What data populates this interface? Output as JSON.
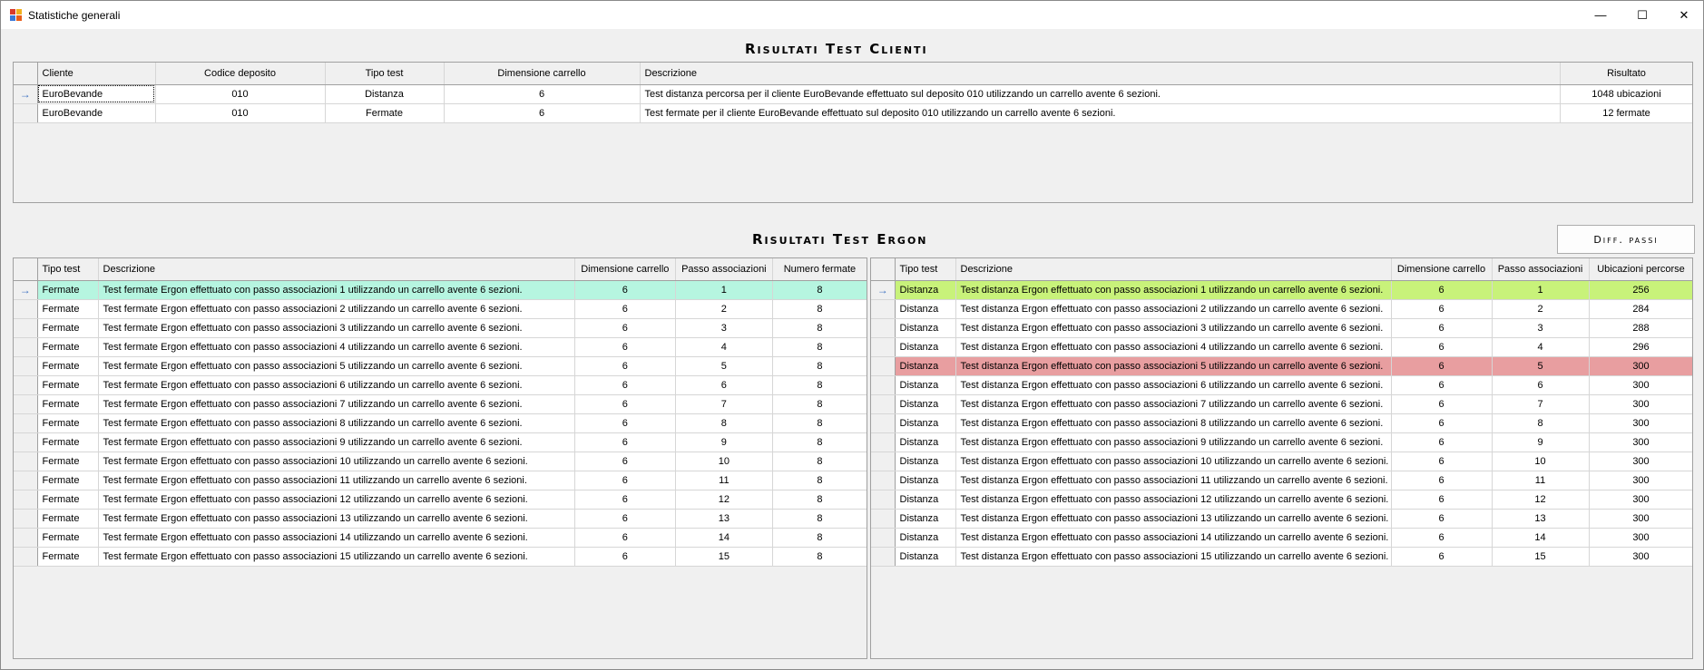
{
  "window": {
    "title": "Statistiche generali",
    "minimize_glyph": "—",
    "maximize_glyph": "☐",
    "close_glyph": "✕"
  },
  "clienti": {
    "title": "Risultati Test Clienti",
    "columns": [
      "Cliente",
      "Codice deposito",
      "Tipo test",
      "Dimensione carrello",
      "Descrizione",
      "Risultato"
    ],
    "rows": [
      [
        "EuroBevande",
        "010",
        "Distanza",
        "6",
        "Test distanza percorsa per il cliente EuroBevande effettuato sul deposito 010 utilizzando un carrello avente 6 sezioni.",
        "1048 ubicazioni"
      ],
      [
        "EuroBevande",
        "010",
        "Fermate",
        "6",
        "Test fermate per il cliente EuroBevande effettuato sul deposito 010 utilizzando un carrello avente 6 sezioni.",
        "12 fermate"
      ]
    ]
  },
  "ergon": {
    "title": "Risultati Test Ergon",
    "diff_button": "Diff. passi",
    "fermate": {
      "columns": [
        "Tipo test",
        "Descrizione",
        "Dimensione carrello",
        "Passo associazioni",
        "Numero fermate"
      ],
      "rows": [
        [
          "Fermate",
          "Test fermate Ergon effettuato con passo associazioni 1 utilizzando un carrello avente 6 sezioni.",
          "6",
          "1",
          "8"
        ],
        [
          "Fermate",
          "Test fermate Ergon effettuato con passo associazioni 2 utilizzando un carrello avente 6 sezioni.",
          "6",
          "2",
          "8"
        ],
        [
          "Fermate",
          "Test fermate Ergon effettuato con passo associazioni 3 utilizzando un carrello avente 6 sezioni.",
          "6",
          "3",
          "8"
        ],
        [
          "Fermate",
          "Test fermate Ergon effettuato con passo associazioni 4 utilizzando un carrello avente 6 sezioni.",
          "6",
          "4",
          "8"
        ],
        [
          "Fermate",
          "Test fermate Ergon effettuato con passo associazioni 5 utilizzando un carrello avente 6 sezioni.",
          "6",
          "5",
          "8"
        ],
        [
          "Fermate",
          "Test fermate Ergon effettuato con passo associazioni 6 utilizzando un carrello avente 6 sezioni.",
          "6",
          "6",
          "8"
        ],
        [
          "Fermate",
          "Test fermate Ergon effettuato con passo associazioni 7 utilizzando un carrello avente 6 sezioni.",
          "6",
          "7",
          "8"
        ],
        [
          "Fermate",
          "Test fermate Ergon effettuato con passo associazioni 8 utilizzando un carrello avente 6 sezioni.",
          "6",
          "8",
          "8"
        ],
        [
          "Fermate",
          "Test fermate Ergon effettuato con passo associazioni 9 utilizzando un carrello avente 6 sezioni.",
          "6",
          "9",
          "8"
        ],
        [
          "Fermate",
          "Test fermate Ergon effettuato con passo associazioni 10 utilizzando un carrello avente 6 sezioni.",
          "6",
          "10",
          "8"
        ],
        [
          "Fermate",
          "Test fermate Ergon effettuato con passo associazioni 11 utilizzando un carrello avente 6 sezioni.",
          "6",
          "11",
          "8"
        ],
        [
          "Fermate",
          "Test fermate Ergon effettuato con passo associazioni 12 utilizzando un carrello avente 6 sezioni.",
          "6",
          "12",
          "8"
        ],
        [
          "Fermate",
          "Test fermate Ergon effettuato con passo associazioni 13 utilizzando un carrello avente 6 sezioni.",
          "6",
          "13",
          "8"
        ],
        [
          "Fermate",
          "Test fermate Ergon effettuato con passo associazioni 14 utilizzando un carrello avente 6 sezioni.",
          "6",
          "14",
          "8"
        ],
        [
          "Fermate",
          "Test fermate Ergon effettuato con passo associazioni 15 utilizzando un carrello avente 6 sezioni.",
          "6",
          "15",
          "8"
        ]
      ]
    },
    "distanza": {
      "columns": [
        "Tipo test",
        "Descrizione",
        "Dimensione carrello",
        "Passo associazioni",
        "Ubicazioni percorse"
      ],
      "rows": [
        [
          "Distanza",
          "Test distanza Ergon effettuato con passo associazioni 1 utilizzando un carrello avente 6 sezioni.",
          "6",
          "1",
          "256"
        ],
        [
          "Distanza",
          "Test distanza Ergon effettuato con passo associazioni 2 utilizzando un carrello avente 6 sezioni.",
          "6",
          "2",
          "284"
        ],
        [
          "Distanza",
          "Test distanza Ergon effettuato con passo associazioni 3 utilizzando un carrello avente 6 sezioni.",
          "6",
          "3",
          "288"
        ],
        [
          "Distanza",
          "Test distanza Ergon effettuato con passo associazioni 4 utilizzando un carrello avente 6 sezioni.",
          "6",
          "4",
          "296"
        ],
        [
          "Distanza",
          "Test distanza Ergon effettuato con passo associazioni 5 utilizzando un carrello avente 6 sezioni.",
          "6",
          "5",
          "300"
        ],
        [
          "Distanza",
          "Test distanza Ergon effettuato con passo associazioni 6 utilizzando un carrello avente 6 sezioni.",
          "6",
          "6",
          "300"
        ],
        [
          "Distanza",
          "Test distanza Ergon effettuato con passo associazioni 7 utilizzando un carrello avente 6 sezioni.",
          "6",
          "7",
          "300"
        ],
        [
          "Distanza",
          "Test distanza Ergon effettuato con passo associazioni 8 utilizzando un carrello avente 6 sezioni.",
          "6",
          "8",
          "300"
        ],
        [
          "Distanza",
          "Test distanza Ergon effettuato con passo associazioni 9 utilizzando un carrello avente 6 sezioni.",
          "6",
          "9",
          "300"
        ],
        [
          "Distanza",
          "Test distanza Ergon effettuato con passo associazioni 10 utilizzando un carrello avente 6 sezioni.",
          "6",
          "10",
          "300"
        ],
        [
          "Distanza",
          "Test distanza Ergon effettuato con passo associazioni 11 utilizzando un carrello avente 6 sezioni.",
          "6",
          "11",
          "300"
        ],
        [
          "Distanza",
          "Test distanza Ergon effettuato con passo associazioni 12 utilizzando un carrello avente 6 sezioni.",
          "6",
          "12",
          "300"
        ],
        [
          "Distanza",
          "Test distanza Ergon effettuato con passo associazioni 13 utilizzando un carrello avente 6 sezioni.",
          "6",
          "13",
          "300"
        ],
        [
          "Distanza",
          "Test distanza Ergon effettuato con passo associazioni 14 utilizzando un carrello avente 6 sezioni.",
          "6",
          "14",
          "300"
        ],
        [
          "Distanza",
          "Test distanza Ergon effettuato con passo associazioni 15 utilizzando un carrello avente 6 sezioni.",
          "6",
          "15",
          "300"
        ]
      ]
    }
  },
  "row_pointer_glyph": "→",
  "colors": {
    "best_fermate": "#b6f5e0",
    "best_distanza": "#c8f27a",
    "first_max_distanza": "#e89ea0",
    "row_pointer": "#3a6fc0"
  }
}
